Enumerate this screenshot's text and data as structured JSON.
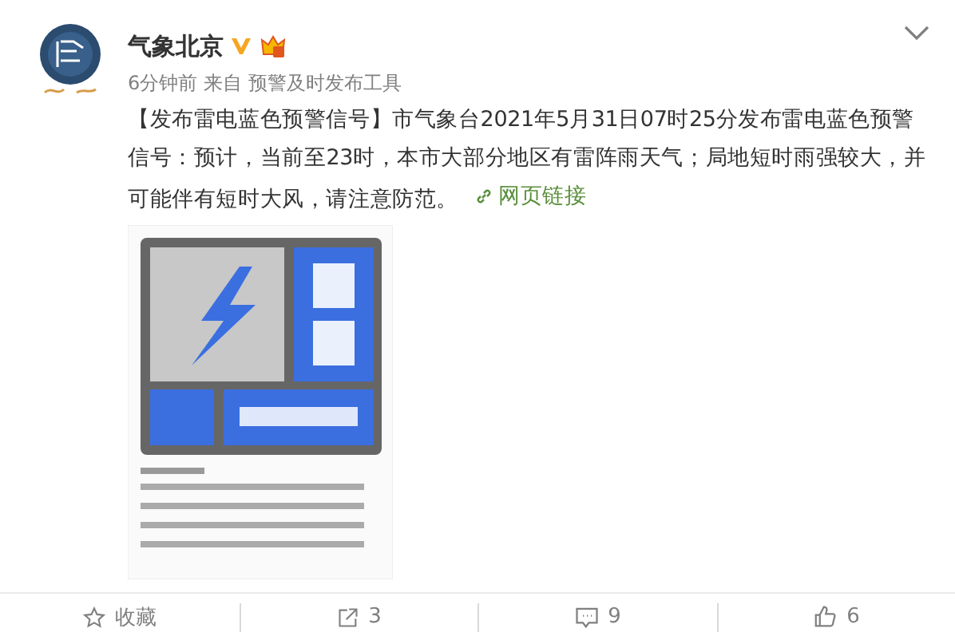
{
  "author": {
    "name": "气象北京",
    "verified": true
  },
  "meta": {
    "time": "6分钟前",
    "from": "来自",
    "source": "预警及时发布工具"
  },
  "post": {
    "text": "【发布雷电蓝色预警信号】市气象台2021年5月31日07时25分发布雷电蓝色预警信号：预计，当前至23时，本市大部分地区有雷阵雨天气；局地短时雨强较大，并可能伴有短时大风，请注意防范。",
    "link": "网页链接"
  },
  "actions": [
    {
      "kind": "favorite",
      "label": "收藏"
    },
    {
      "kind": "repost",
      "label": "3"
    },
    {
      "kind": "comment",
      "label": "9"
    },
    {
      "kind": "like",
      "label": "6"
    }
  ]
}
